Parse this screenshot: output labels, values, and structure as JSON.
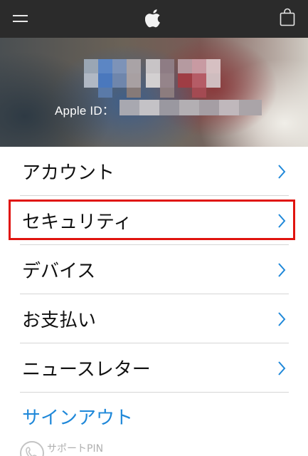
{
  "header": {
    "menu_icon": "hamburger-menu-icon",
    "logo_icon": "apple-logo-icon",
    "bag_icon": "shopping-bag-icon",
    "bar_color": "#2b2b2b"
  },
  "profile": {
    "apple_id_label": "Apple ID："
  },
  "menu": {
    "items": [
      {
        "label": "アカウント"
      },
      {
        "label": "セキュリティ"
      },
      {
        "label": "デバイス"
      },
      {
        "label": "お支払い"
      },
      {
        "label": "ニュースレター"
      }
    ],
    "chevron_icon": "chevron-right-icon",
    "chevron_color": "#1f88d9"
  },
  "highlight_color": "#e0140f",
  "signout_label": "サインアウト",
  "support": {
    "label": "サポートPIN",
    "icon": "phone-icon"
  }
}
